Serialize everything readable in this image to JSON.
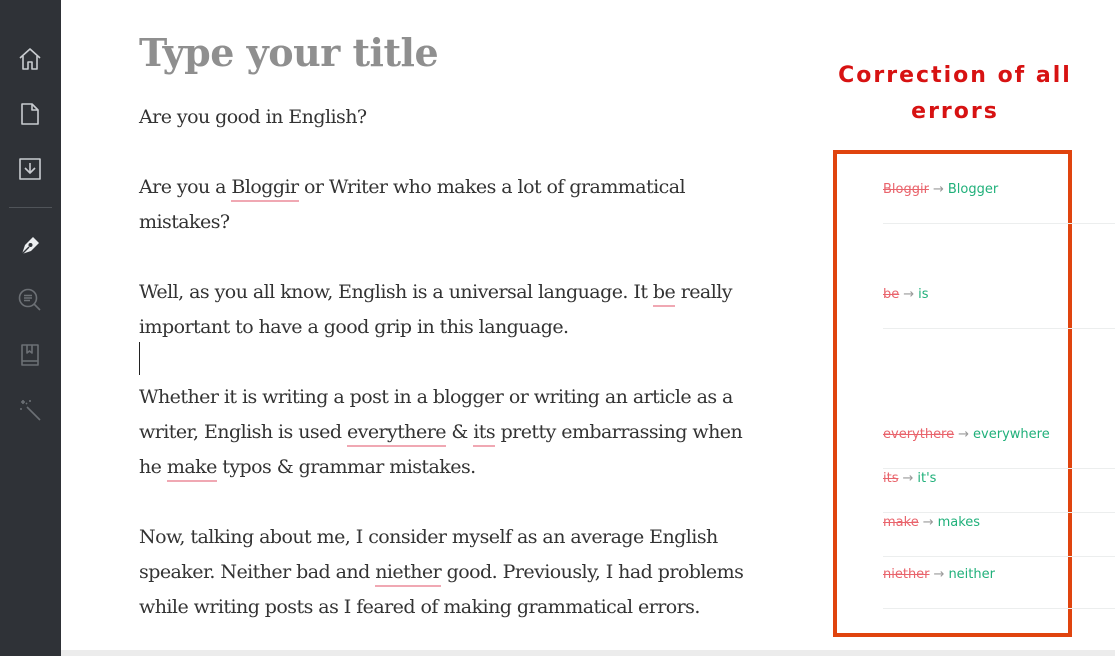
{
  "sidebar": {
    "items": [
      {
        "icon": "home-icon",
        "label": ""
      },
      {
        "icon": "document-icon",
        "label": ""
      },
      {
        "icon": "download-icon",
        "label": ""
      },
      {
        "icon": "pen-icon",
        "label": ""
      },
      {
        "icon": "search-text-icon",
        "label": ""
      },
      {
        "icon": "book-icon",
        "label": ""
      },
      {
        "icon": "magic-wand-icon",
        "label": ""
      }
    ]
  },
  "editor": {
    "title_placeholder": "Type your title",
    "paragraphs": [
      {
        "segments": [
          {
            "text": "Are you good in English?"
          }
        ]
      },
      {
        "segments": [
          {
            "text": "Are you a "
          },
          {
            "text": "Bloggir",
            "error": true
          },
          {
            "text": " or Writer who makes a lot of grammatical mistakes?"
          }
        ]
      },
      {
        "segments": [
          {
            "text": "Well, as you all know, English is a universal language. It "
          },
          {
            "text": "be",
            "error": true
          },
          {
            "text": " really important to have a good grip in this language."
          }
        ]
      },
      {
        "segments": [
          {
            "text": "Whether it is writing a post in a blogger or writing an article as a writer, English is used "
          },
          {
            "text": "everythere",
            "error": true
          },
          {
            "text": " & "
          },
          {
            "text": "its",
            "error": true
          },
          {
            "text": " pretty embarrassing when he "
          },
          {
            "text": "make",
            "error": true
          },
          {
            "text": " typos & grammar mistakes."
          }
        ]
      },
      {
        "segments": [
          {
            "text": "Now, talking about me, I consider myself as an average English speaker. Neither bad and "
          },
          {
            "text": "niether",
            "error": true
          },
          {
            "text": " good. Previously, I had problems while writing posts as I feared of making grammatical errors."
          }
        ]
      }
    ]
  },
  "annotation": {
    "text": "Correction of all errors",
    "color": "#d71212"
  },
  "corrections": [
    {
      "wrong": "Bloggir",
      "right": "Blogger"
    },
    {
      "wrong": "be",
      "right": "is"
    },
    {
      "wrong": "everythere",
      "right": "everywhere"
    },
    {
      "wrong": "its",
      "right": "it's"
    },
    {
      "wrong": "make",
      "right": "makes"
    },
    {
      "wrong": "niether",
      "right": "neither"
    }
  ],
  "colors": {
    "sidebar_bg": "#2f3237",
    "error_underline": "#f0a8b3",
    "wrong_text": "#e9646c",
    "correct_text": "#20b07a",
    "highlight_box": "#e0440e"
  }
}
